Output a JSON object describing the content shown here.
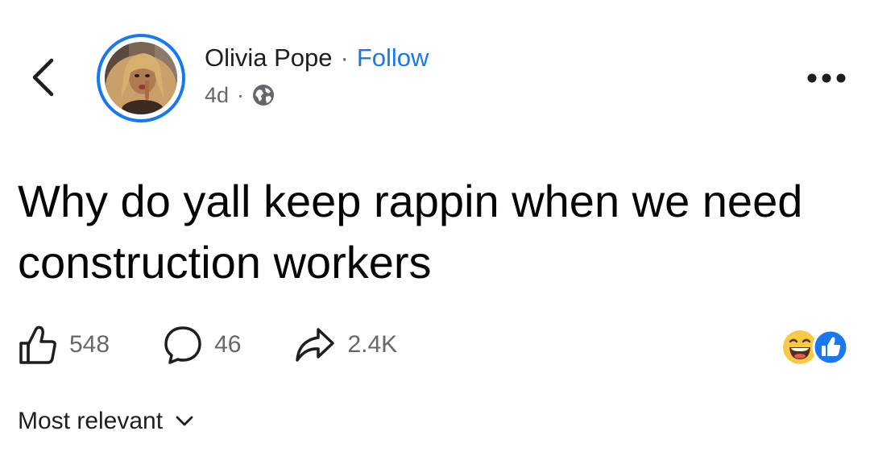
{
  "post": {
    "author": "Olivia Pope",
    "separator": "·",
    "follow_label": "Follow",
    "time": "4d",
    "meta_separator": "·",
    "privacy_icon": "globe-icon",
    "text": "Why do yall keep rappin when we need construction workers"
  },
  "actions": {
    "like_count": "548",
    "comment_count": "46",
    "share_count": "2.4K"
  },
  "reactions": [
    "haha-icon",
    "like-icon"
  ],
  "comments": {
    "sort_label": "Most relevant"
  },
  "colors": {
    "accent": "#1877f2",
    "text": "#1c1e21",
    "secondary": "#65676b",
    "haha": "#f7c947"
  }
}
